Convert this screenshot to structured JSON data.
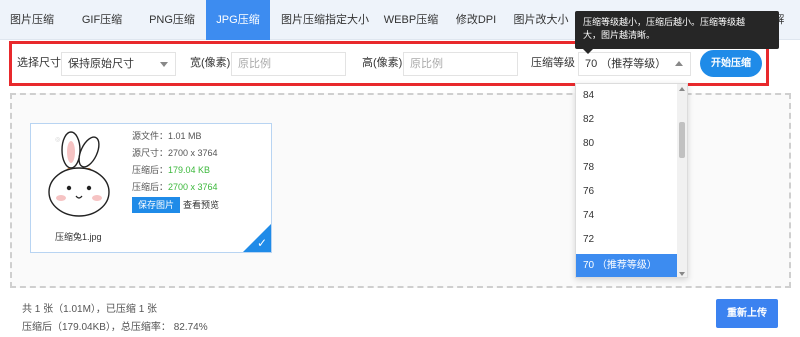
{
  "tabs": [
    {
      "label": "图片压缩"
    },
    {
      "label": "GIF压缩"
    },
    {
      "label": "PNG压缩"
    },
    {
      "label": "JPG压缩",
      "active": true
    },
    {
      "label": "图片压缩指定大小"
    },
    {
      "label": "WEBP压缩"
    },
    {
      "label": "修改DPI"
    },
    {
      "label": "图片改大小"
    },
    {
      "label": "GIF分解"
    }
  ],
  "options": {
    "size_label": "选择尺寸",
    "size_value": "保持原始尺寸",
    "width_label": "宽(像素)",
    "width_placeholder": "原比例",
    "height_label": "高(像素)",
    "height_placeholder": "原比例",
    "level_label": "压缩等级",
    "level_value": "70 （推荐等级）",
    "start_button": "开始压缩"
  },
  "tooltip": {
    "line1": "压缩等级越小，压缩后越小。压缩等级越",
    "line2": "大，图片越清晰。"
  },
  "dropdown": {
    "options": [
      "84",
      "82",
      "80",
      "78",
      "76",
      "74",
      "72",
      "70 （推荐等级）"
    ],
    "selected": "70 （推荐等级）"
  },
  "file_card": {
    "source_size_label": "源文件：",
    "source_size": "1.01 MB",
    "source_dim_label": "源尺寸：",
    "source_dim": "2700 x 3764",
    "compressed_label": "压缩后：",
    "compressed_size": "179.04 KB",
    "compressed_dim_label": "压缩后：",
    "compressed_dim": "2700 x 3764",
    "save_button": "保存图片",
    "preview_link": "查看预览",
    "filename": "压缩兔1.jpg"
  },
  "summary": {
    "line1": "共 1 张（1.01M），已压缩 1 张",
    "line2": "压缩后（179.04KB），总压缩率： 82.74%"
  },
  "reupload_button": "重新上传",
  "colors": {
    "accent": "#3d8cf0",
    "button": "#1f8be8",
    "highlight_border": "#e8292c",
    "success_text": "#3cb83c"
  }
}
